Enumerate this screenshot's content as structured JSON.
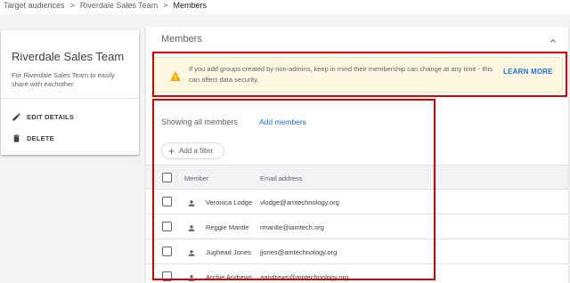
{
  "breadcrumb": {
    "items": [
      "Target audiences",
      "Riverdale Sales Team"
    ],
    "current": "Members",
    "separator": ">"
  },
  "group": {
    "name": "Riverdale Sales Team",
    "description": "For Riverdale Sales Team to easily share with eachother",
    "actions": [
      {
        "label": "EDIT DETAILS",
        "icon": "pencil-icon"
      },
      {
        "label": "DELETE",
        "icon": "trash-icon"
      }
    ]
  },
  "members_panel": {
    "title": "Members",
    "warning": {
      "text": "If you add groups created by non-admins, keep in mind their membership can change at any time - this can affect data security.",
      "link": "LEARN MORE"
    },
    "showing": "Showing all members",
    "add_members": "Add members",
    "filter": "Add a filter",
    "columns": [
      "Member",
      "Email address"
    ],
    "rows": [
      {
        "name": "Veronica Lodge",
        "email": "vlodge@amtechnology.org"
      },
      {
        "name": "Reggie Mantle",
        "email": "rmantle@iamtech.org"
      },
      {
        "name": "Jughead Jones",
        "email": "jjones@amtechnology.org"
      },
      {
        "name": "Archie Andrews",
        "email": "aandrews@amtechnology.org"
      }
    ]
  },
  "colors": {
    "accent": "#1a73e8",
    "highlight": "#e00000",
    "warning_bg": "#fef7e0",
    "warning_icon": "#f9ab00"
  }
}
